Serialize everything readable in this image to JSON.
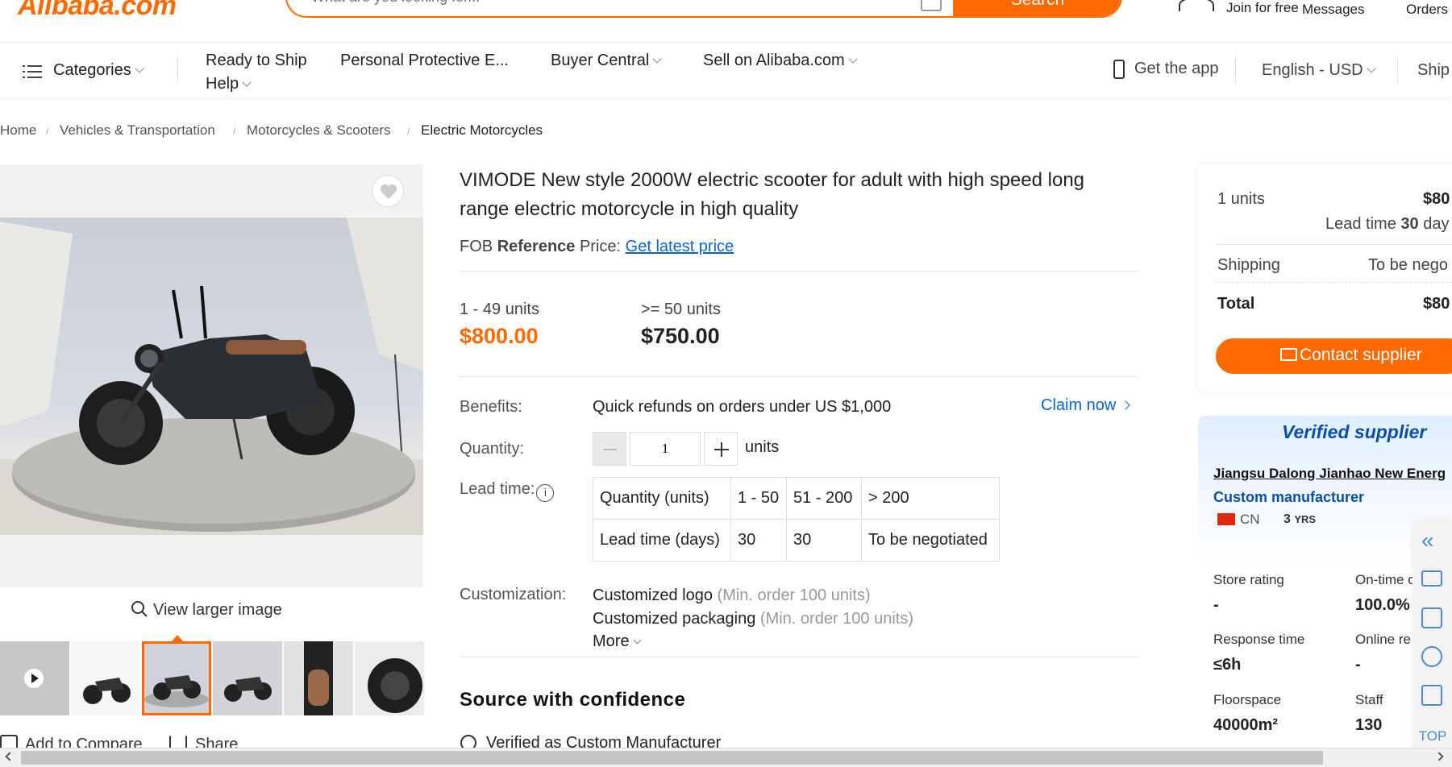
{
  "header": {
    "logo": "Alibaba.com",
    "search_placeholder": "What are you looking for...",
    "search_button": "Search",
    "join_label": "Join for free",
    "messages_label": "Messages",
    "orders_label": "Orders"
  },
  "nav": {
    "categories": "Categories",
    "ready_to_ship": "Ready to Ship",
    "ppe": "Personal Protective E...",
    "buyer_central": "Buyer Central",
    "sell": "Sell on Alibaba.com",
    "help": "Help",
    "get_app": "Get the app",
    "language": "English - USD",
    "ship": "Ship"
  },
  "breadcrumb": [
    "Home",
    "Vehicles & Transportation",
    "Motorcycles & Scooters",
    "Electric Motorcycles"
  ],
  "gallery": {
    "view_larger": "View larger image",
    "add_to_compare": "Add to Compare",
    "share": "Share"
  },
  "product": {
    "title": "VIMODE New style 2000W electric scooter for adult with high speed long range electric motorcycle in high quality",
    "fob_prefix": "FOB",
    "fob_bold": "Reference",
    "fob_suffix": "Price:",
    "fob_link": "Get latest price",
    "tiers": [
      {
        "qty": "1 - 49 units",
        "price": "$800.00"
      },
      {
        "qty": ">= 50 units",
        "price": "$750.00"
      }
    ],
    "benefits_label": "Benefits:",
    "benefits_text": "Quick refunds on orders under US $1,000",
    "claim_now": "Claim now",
    "quantity_label": "Quantity:",
    "quantity_value": "1",
    "quantity_unit": "units",
    "lead_time_label": "Lead time:",
    "lead_table": {
      "header": [
        "Quantity (units)",
        "1 - 50",
        "51 - 200",
        "> 200"
      ],
      "row": [
        "Lead time (days)",
        "30",
        "30",
        "To be negotiated"
      ]
    },
    "customization_label": "Customization:",
    "customizations": [
      {
        "name": "Customized logo",
        "min": "(Min. order 100 units)"
      },
      {
        "name": "Customized packaging",
        "min": "(Min. order 100 units)"
      }
    ],
    "more": "More",
    "source_heading": "Source with confidence",
    "verified_item": "Verified as Custom Manufacturer"
  },
  "order_card": {
    "units": "1 units",
    "unit_price": "$80",
    "lead_time_text": "Lead time",
    "lead_time_value": "30",
    "lead_time_unit": "day",
    "shipping_label": "Shipping",
    "shipping_value": "To be nego",
    "total_label": "Total",
    "total_value": "$80",
    "contact_button": "Contact supplier"
  },
  "supplier": {
    "badge": "Verified supplier",
    "name": "Jiangsu Dalong Jianhao New Energ",
    "type": "Custom manufacturer",
    "country": "CN",
    "years_num": "3",
    "years_unit": "YRS",
    "stats": [
      {
        "label": "Store rating",
        "value": "-"
      },
      {
        "label": "On-time c",
        "value": "100.0%"
      },
      {
        "label": "Response time",
        "value": "≤6h"
      },
      {
        "label": "Online re",
        "value": "-"
      },
      {
        "label": "Floorspace",
        "value": "40000m²"
      },
      {
        "label": "Staff",
        "value": "130"
      }
    ]
  },
  "side_tools": {
    "top_label": "TOP"
  },
  "colors": {
    "brand": "#ff6a00",
    "link": "#0a64d6",
    "supplier_blue": "#0a4fa8"
  }
}
